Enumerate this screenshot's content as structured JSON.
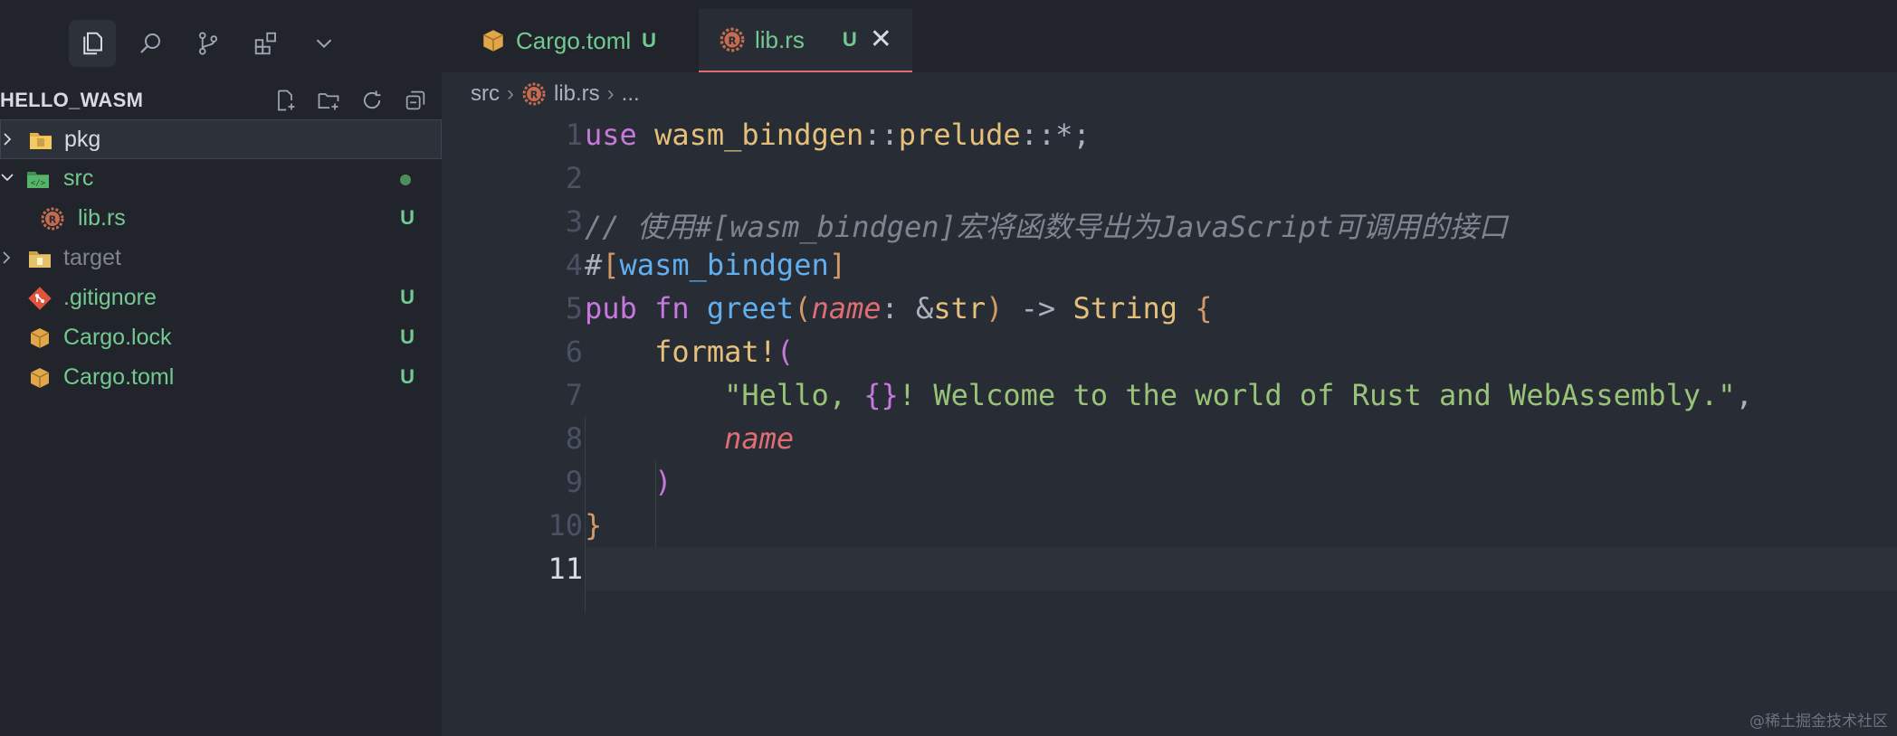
{
  "sidebar": {
    "explorer_title": "HELLO_WASM",
    "items": [
      {
        "label": "pkg",
        "badge": "",
        "type": "folder"
      },
      {
        "label": "src",
        "badge": "",
        "type": "folder-open"
      },
      {
        "label": "lib.rs",
        "badge": "U",
        "type": "rust"
      },
      {
        "label": "target",
        "badge": "",
        "type": "folder"
      },
      {
        "label": ".gitignore",
        "badge": "U",
        "type": "git"
      },
      {
        "label": "Cargo.lock",
        "badge": "U",
        "type": "cargo"
      },
      {
        "label": "Cargo.toml",
        "badge": "U",
        "type": "cargo"
      }
    ]
  },
  "tabs": [
    {
      "label": "Cargo.toml",
      "badge": "U",
      "active": false
    },
    {
      "label": "lib.rs",
      "badge": "U",
      "active": true,
      "close": "✕"
    }
  ],
  "breadcrumb": {
    "seg1": "src",
    "seg2": "lib.rs",
    "seg3": "..."
  },
  "editor": {
    "line_numbers": [
      "1",
      "2",
      "3",
      "4",
      "5",
      "6",
      "7",
      "8",
      "9",
      "10",
      "11"
    ],
    "lines": {
      "l1": {
        "kw": "use",
        "mod1": "wasm_bindgen",
        "sep1": "::",
        "mod2": "prelude",
        "sep2": "::*;"
      },
      "l3": {
        "comment": "// 使用#[wasm_bindgen]宏将函数导出为JavaScript可调用的接口"
      },
      "l4": {
        "hash": "#",
        "open": "[",
        "attr": "wasm_bindgen",
        "close": "]"
      },
      "l5": {
        "pub": "pub",
        "fnkw": "fn",
        "fname": "greet",
        "paren_open": "(",
        "param": "name",
        "colon": ": &",
        "ty_str": "str",
        "paren_close": ")",
        "arrow": " -> ",
        "ty_ret": "String",
        "brace": "{"
      },
      "l6": {
        "macro": "format!",
        "paren": "("
      },
      "l7": {
        "str1": "\"Hello, ",
        "ph": "{}",
        "str2": "! Welcome to the world of Rust and WebAssembly.\"",
        "comma": ","
      },
      "l8": {
        "arg": "name"
      },
      "l9": {
        "paren": ")"
      },
      "l10": {
        "brace": "}"
      }
    }
  },
  "watermark": "@稀土掘金技术社区"
}
